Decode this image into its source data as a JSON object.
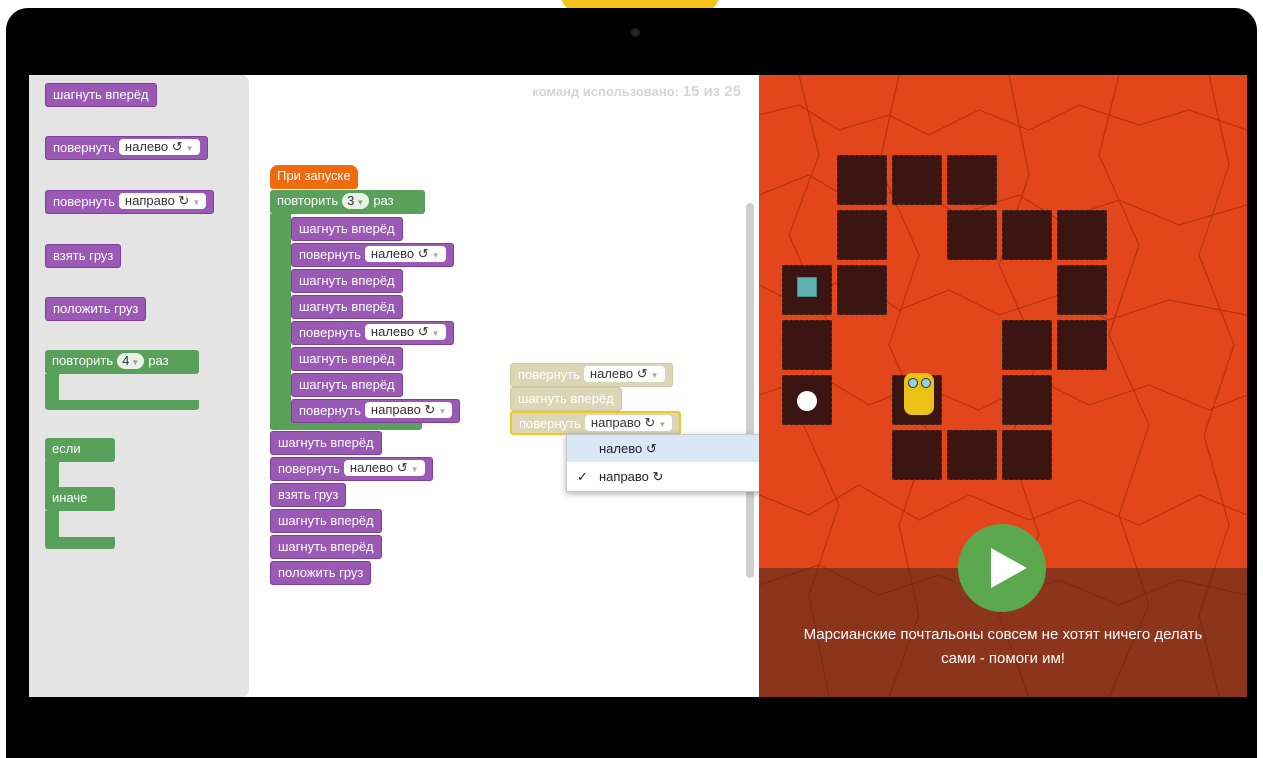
{
  "counter": {
    "label": "команд использовано:",
    "value": "15 из 25"
  },
  "toolbox": {
    "step": "шагнуть вперёд",
    "turn_left_label": "повернуть",
    "turn_left_value": "налево ↺",
    "turn_right_label": "повернуть",
    "turn_right_value": "направо ↻",
    "take": "взять груз",
    "put": "положить груз",
    "repeat_label": "повторить",
    "repeat_count": "4",
    "repeat_suffix": "раз",
    "if_label": "если",
    "else_label": "иначе"
  },
  "program": {
    "start": "При запуске",
    "repeat_label": "повторить",
    "repeat_count": "3",
    "repeat_suffix": "раз",
    "inner": [
      {
        "label": "шагнуть вперёд",
        "value": ""
      },
      {
        "label": "повернуть",
        "value": "налево ↺"
      },
      {
        "label": "шагнуть вперёд",
        "value": ""
      },
      {
        "label": "шагнуть вперёд",
        "value": ""
      },
      {
        "label": "повернуть",
        "value": "налево ↺"
      },
      {
        "label": "шагнуть вперёд",
        "value": ""
      },
      {
        "label": "шагнуть вперёд",
        "value": ""
      },
      {
        "label": "повернуть",
        "value": "направо ↻"
      }
    ],
    "after": [
      {
        "label": "шагнуть вперёд",
        "value": ""
      },
      {
        "label": "повернуть",
        "value": "налево ↺"
      },
      {
        "label": "взять груз",
        "value": ""
      },
      {
        "label": "шагнуть вперёд",
        "value": ""
      },
      {
        "label": "шагнуть вперёд",
        "value": ""
      },
      {
        "label": "положить груз",
        "value": ""
      }
    ]
  },
  "ghost": [
    {
      "label": "повернуть",
      "value": "налево ↺"
    },
    {
      "label": "шагнуть вперёд",
      "value": ""
    },
    {
      "label": "повернуть",
      "value": "направо ↻"
    }
  ],
  "dropdown": {
    "options": [
      "налево ↺",
      "направо ↻"
    ],
    "selected": "направо ↻",
    "check": "✓"
  },
  "game": {
    "caption_line1": "Марсианские почтальоны совсем не хотят ничего делать",
    "caption_line2": "сами - помоги им!"
  },
  "colors": {
    "motion": "#9b59b6",
    "loop": "#59a05a",
    "event": "#f06a0f",
    "ground": "#e4461c",
    "path": "#3b1512",
    "play": "#5ca84f"
  }
}
